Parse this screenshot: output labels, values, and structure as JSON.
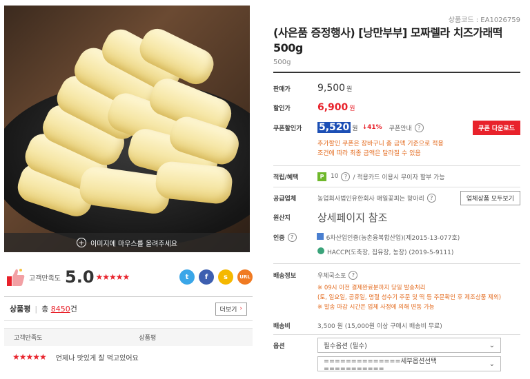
{
  "image": {
    "hover_text": "이미지에 마우스를 올려주세요"
  },
  "rating": {
    "label": "고객만족도",
    "score": "5.0",
    "stars": "★★★★★"
  },
  "share": {
    "twitter": "t",
    "facebook": "f",
    "kakao": "s",
    "url": "URL"
  },
  "review_summary": {
    "label": "상품평",
    "total_prefix": "총",
    "count": "8450",
    "suffix": "건",
    "more": "더보기"
  },
  "review_table": {
    "headers": [
      "고객만족도",
      "상품평"
    ],
    "rows": [
      {
        "stars": "★★★★★",
        "text": "언제나 맛있게 잘 먹고있어요"
      }
    ]
  },
  "product": {
    "code": "상품코드 : EA1026759",
    "title": "(사은품 증정행사) [낭만부부] 모짜렐라 치즈가래떡 500g",
    "subtitle": "500g"
  },
  "pricing": {
    "sale_label": "판매가",
    "sale_price": "9,500",
    "won": "원",
    "discount_label": "할인가",
    "discount_price": "6,900",
    "coupon_label": "쿠폰할인가",
    "coupon_price": "5,520",
    "coupon_pct": "↓41%",
    "coupon_info": "쿠폰안내",
    "coupon_button": "쿠폰 다운로드",
    "coupon_note_1": "추가할인 쿠폰은 장바구니 총 금액 기준으로 적용",
    "coupon_note_2": "조건에 따라 최종 금액은 달라질 수 있음"
  },
  "benefit": {
    "label": "적립/혜택",
    "badge": "P",
    "points": "10",
    "card": "/ 적용카드 이용시 무이자 할부 가능"
  },
  "supplier": {
    "label": "공급업체",
    "name": "농업회사법인유한회사 매일꽃피는 항아리",
    "button": "업체상품 모두보기"
  },
  "origin": {
    "label": "원산지",
    "value": "상세페이지 참조"
  },
  "cert": {
    "label": "인증",
    "item1": "6차산업인증(농촌융복합산업)(제2015-13-077호)",
    "item2": "HACCP(도축장, 집유장, 농장) (2019-5-9111)"
  },
  "shipping": {
    "label": "배송정보",
    "method": "우체국소포",
    "note1": "※ 09시 이전 결제완료분까지 당일 발송처리",
    "note2": "(토, 일요일, 공휴일, 명절 성수기 주문 및 떡 등 주문확인 후 제조상품 제외)",
    "note3": "※ 발송 마감 시간은 업체 사정에 의해 변동 가능"
  },
  "fee": {
    "label": "배송비",
    "value": "3,500 원 (15,000원 이상 구매시 배송비 무료)"
  },
  "options": {
    "label": "옵션",
    "select1": "필수옵션 (필수)",
    "select2": "==============세부옵션선택==========="
  },
  "colors": {
    "accent_red": "#e8222b",
    "coupon_blue": "#1c4fb5",
    "note_orange": "#e36a1d"
  }
}
